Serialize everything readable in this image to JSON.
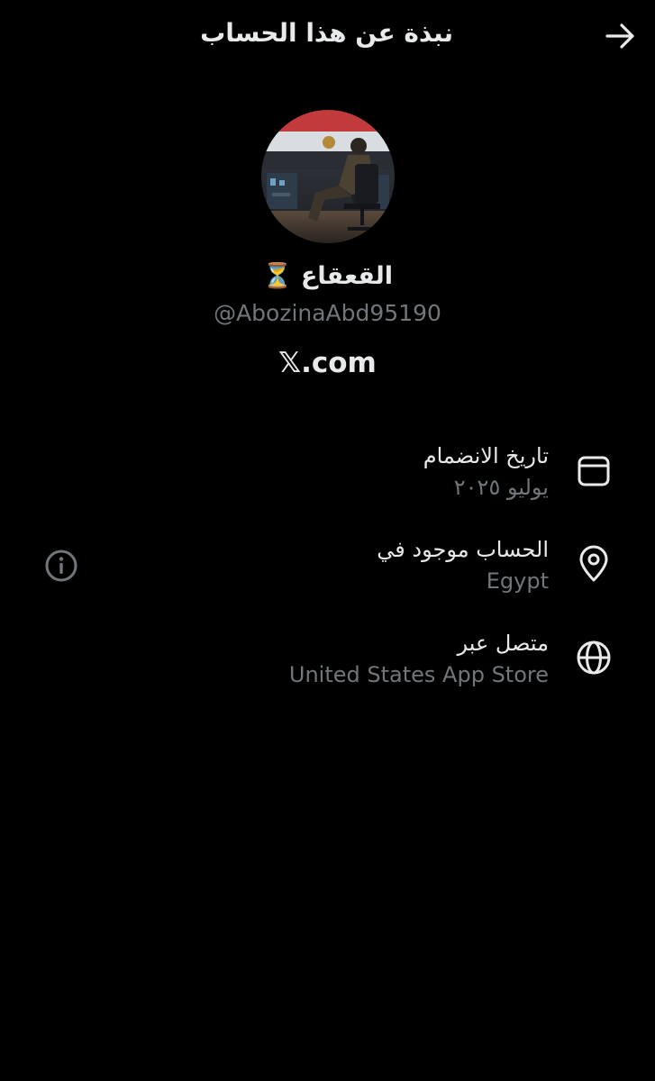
{
  "header": {
    "title": "نبذة عن هذا الحساب"
  },
  "profile": {
    "display_name": "القعقاع ⏳",
    "handle": "@AbozinaAbd95190",
    "source_label": "𝕏.com"
  },
  "rows": [
    {
      "label": "تاريخ الانضمام",
      "value": "يوليو ٢٠٢٥",
      "icon": "calendar-icon"
    },
    {
      "label": "الحساب موجود في",
      "value": "Egypt",
      "icon": "location-pin-icon"
    },
    {
      "label": "متصل عبر",
      "value": "United States App Store",
      "icon": "globe-icon"
    }
  ],
  "colors": {
    "background": "#000000",
    "primary_text": "#e7e9ea",
    "secondary_text": "#71767b"
  }
}
